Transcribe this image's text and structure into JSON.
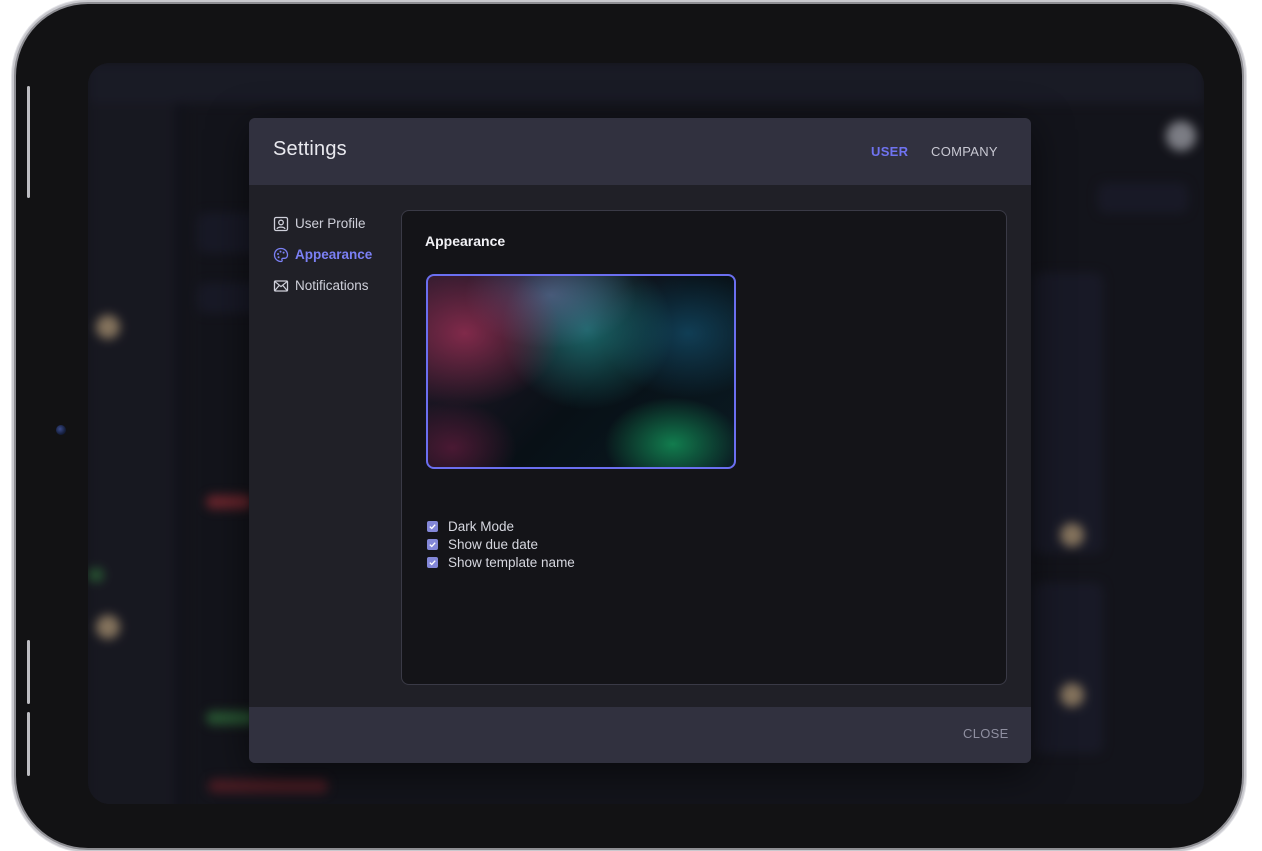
{
  "modal": {
    "title": "Settings",
    "tabs": [
      {
        "label": "USER",
        "active": true
      },
      {
        "label": "COMPANY",
        "active": false
      }
    ],
    "close_label": "CLOSE"
  },
  "sidebar": {
    "items": [
      {
        "label": "User Profile",
        "icon": "user-profile-icon",
        "active": false
      },
      {
        "label": "Appearance",
        "icon": "palette-icon",
        "active": true
      },
      {
        "label": "Notifications",
        "icon": "mail-icon",
        "active": false
      }
    ]
  },
  "content": {
    "title": "Appearance",
    "checkboxes": [
      {
        "label": "Dark Mode",
        "checked": true
      },
      {
        "label": "Show due date",
        "checked": true
      },
      {
        "label": "Show template name",
        "checked": true
      }
    ]
  },
  "colors": {
    "accent": "#6f73f0",
    "checkbox": "#8387d8",
    "modal_header": "#31313f",
    "modal_body": "#202027",
    "panel": "#141418"
  }
}
